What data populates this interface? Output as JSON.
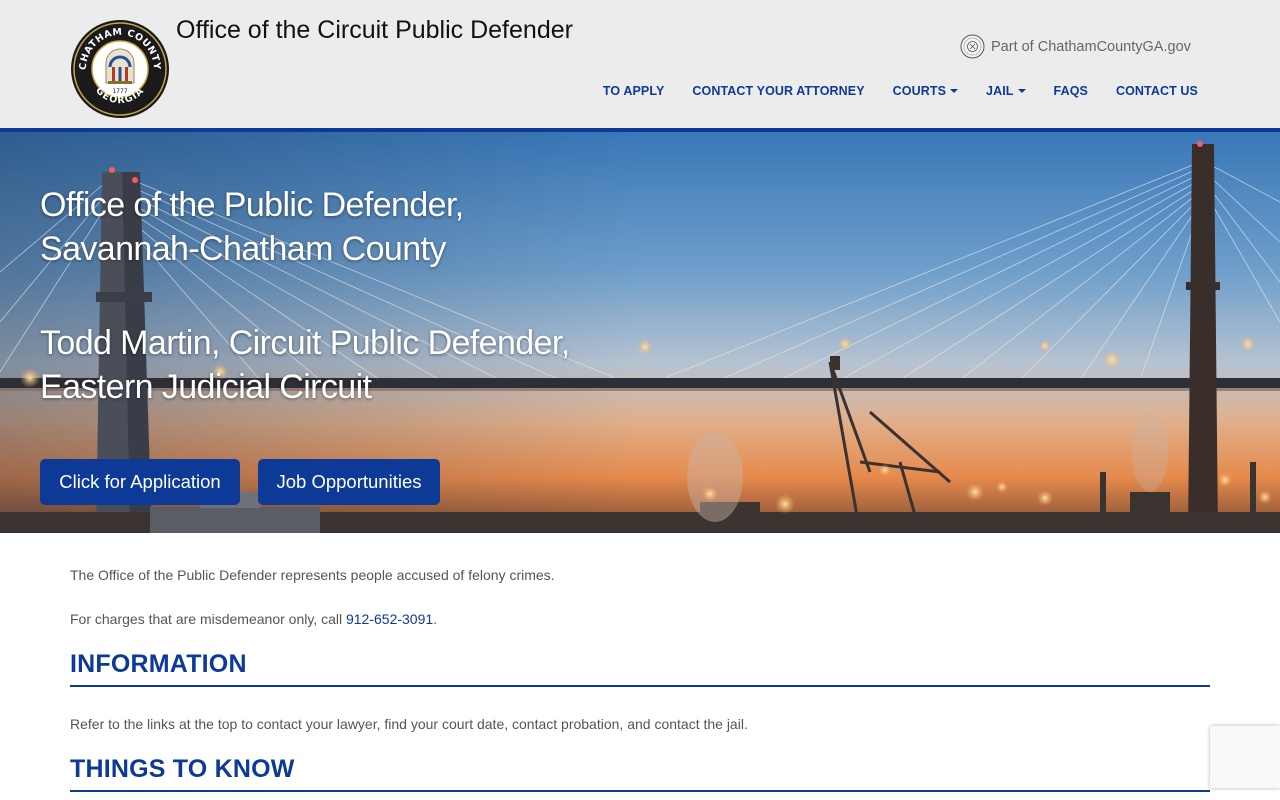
{
  "header": {
    "site_title": "Office of the Circuit Public Defender",
    "seal": {
      "top_text": "CHATHAM COUNTY",
      "bottom_text": "GEORGIA",
      "year": "1777"
    },
    "county_link": "Part of ChathamCountyGA.gov",
    "nav": [
      {
        "label": "TO APPLY",
        "dropdown": false
      },
      {
        "label": "CONTACT YOUR ATTORNEY",
        "dropdown": false
      },
      {
        "label": "COURTS",
        "dropdown": true
      },
      {
        "label": "JAIL",
        "dropdown": true
      },
      {
        "label": "FAQS",
        "dropdown": false
      },
      {
        "label": "CONTACT US",
        "dropdown": false
      }
    ]
  },
  "hero": {
    "line1": "Office of the Public Defender,",
    "line2": "Savannah-Chatham County",
    "line3": "Todd Martin, Circuit Public Defender,",
    "line4": "Eastern Judicial Circuit",
    "buttons": {
      "apply": "Click for Application",
      "jobs": "Job Opportunities"
    }
  },
  "content": {
    "intro": "The Office of the Public Defender represents people accused of felony crimes.",
    "misdemeanor_prefix": "For charges that are misdemeanor only, call ",
    "misdemeanor_phone": "912-652-3091",
    "misdemeanor_suffix": ".",
    "info_heading": "INFORMATION",
    "info_text": "Refer to the links at the top to contact your lawyer, find your court date, contact probation, and contact the jail.",
    "things_heading": "THINGS TO KNOW"
  },
  "colors": {
    "brand_blue": "#0d3a97",
    "header_bg": "#ececec",
    "body_text": "#555555"
  }
}
